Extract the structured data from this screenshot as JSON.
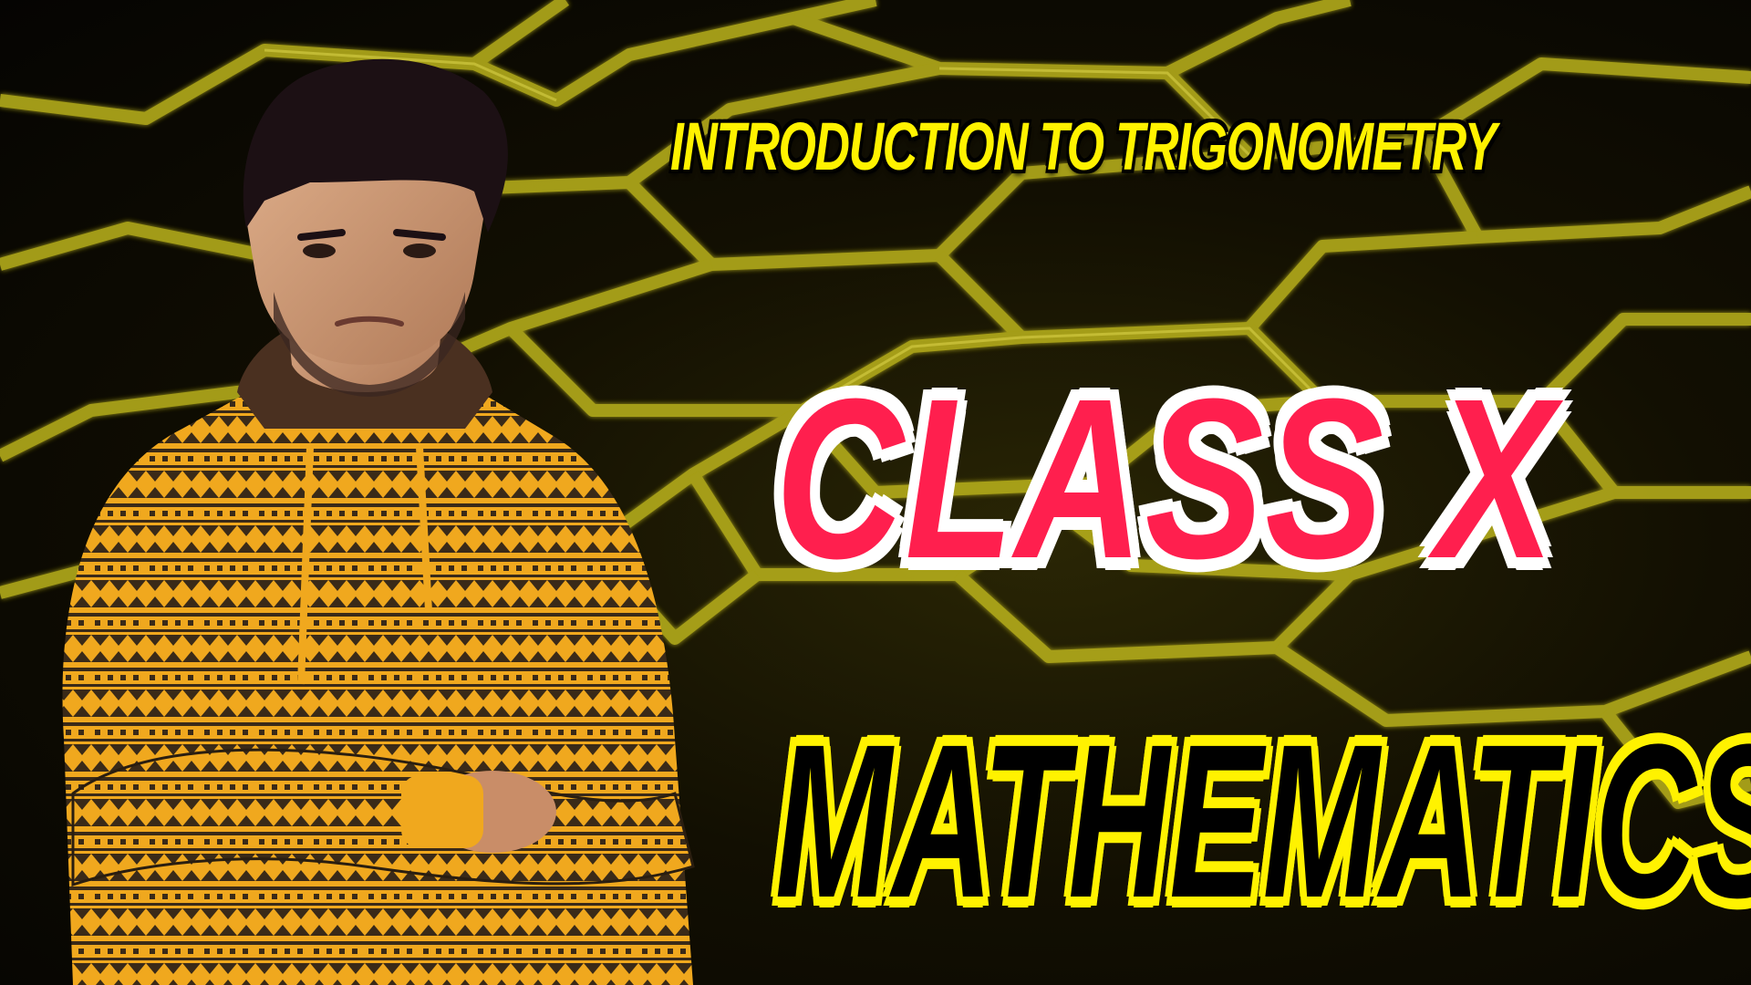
{
  "thumbnail": {
    "subtitle": "INTRODUCTION TO TRIGONOMETRY",
    "class_title": "CLASS  X",
    "subject_title": "MATHEMATICS"
  },
  "colors": {
    "background": "#050402",
    "grid_line": "#c9c21a",
    "subtitle_fill": "#fff200",
    "class_fill": "#ff1f4e",
    "class_outline": "#ffffff",
    "subject_fill": "#000000",
    "subject_outline": "#fff200",
    "hoodie": "#f0a81e",
    "hoodie_pattern": "#3a2a18"
  },
  "icons": {
    "background": "hexagon-grid",
    "person": "presenter-photo"
  }
}
